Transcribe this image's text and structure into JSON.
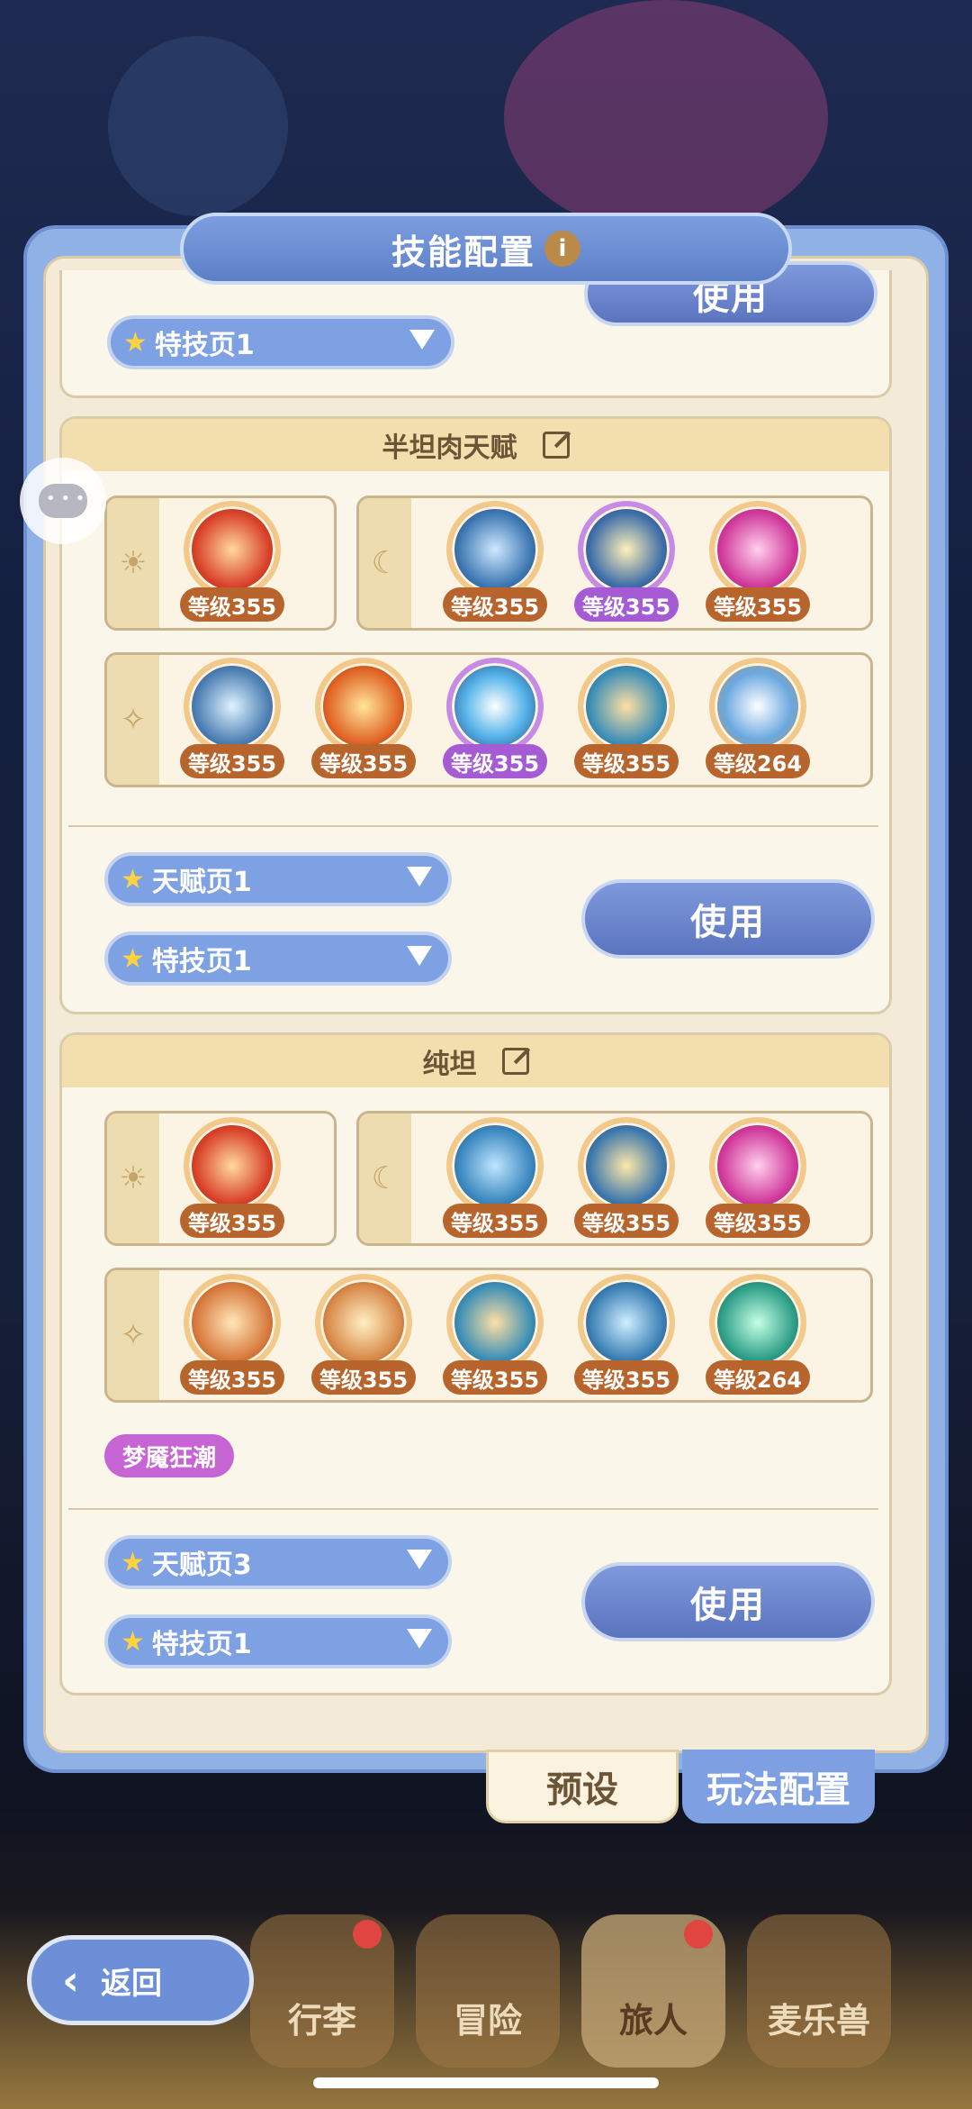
{
  "title": "技能配置",
  "info_icon": "i",
  "top_partial": {
    "dropdown": "特技页1",
    "use": "使用"
  },
  "cards": [
    {
      "name": "半坦肉天赋",
      "row1_left": [
        {
          "level": "等级355",
          "color": "orange"
        }
      ],
      "row1_right": [
        {
          "level": "等级355",
          "color": "orange"
        },
        {
          "level": "等级355",
          "color": "purple"
        },
        {
          "level": "等级355",
          "color": "orange"
        }
      ],
      "row2": [
        {
          "level": "等级355",
          "color": "orange"
        },
        {
          "level": "等级355",
          "color": "orange"
        },
        {
          "level": "等级355",
          "color": "purple"
        },
        {
          "level": "等级355",
          "color": "orange"
        },
        {
          "level": "等级264",
          "color": "orange"
        }
      ],
      "dropdown_talent": "天赋页1",
      "dropdown_skill": "特技页1",
      "use": "使用"
    },
    {
      "name": "纯坦",
      "row1_left": [
        {
          "level": "等级355",
          "color": "orange"
        }
      ],
      "row1_right": [
        {
          "level": "等级355",
          "color": "orange"
        },
        {
          "level": "等级355",
          "color": "orange"
        },
        {
          "level": "等级355",
          "color": "orange"
        }
      ],
      "row2": [
        {
          "level": "等级355",
          "color": "orange"
        },
        {
          "level": "等级355",
          "color": "orange"
        },
        {
          "level": "等级355",
          "color": "orange"
        },
        {
          "level": "等级355",
          "color": "orange"
        },
        {
          "level": "等级264",
          "color": "orange"
        }
      ],
      "tag": "梦魇狂潮",
      "dropdown_talent": "天赋页3",
      "dropdown_skill": "特技页1",
      "use": "使用"
    }
  ],
  "tabs": {
    "preset": "预设",
    "play": "玩法配置"
  },
  "back": "返回",
  "nav": [
    "行李",
    "冒险",
    "旅人",
    "麦乐兽"
  ],
  "icons": {
    "sun": "sun-icon",
    "moon": "moon-icon",
    "sparkle": "sparkle-icon"
  }
}
